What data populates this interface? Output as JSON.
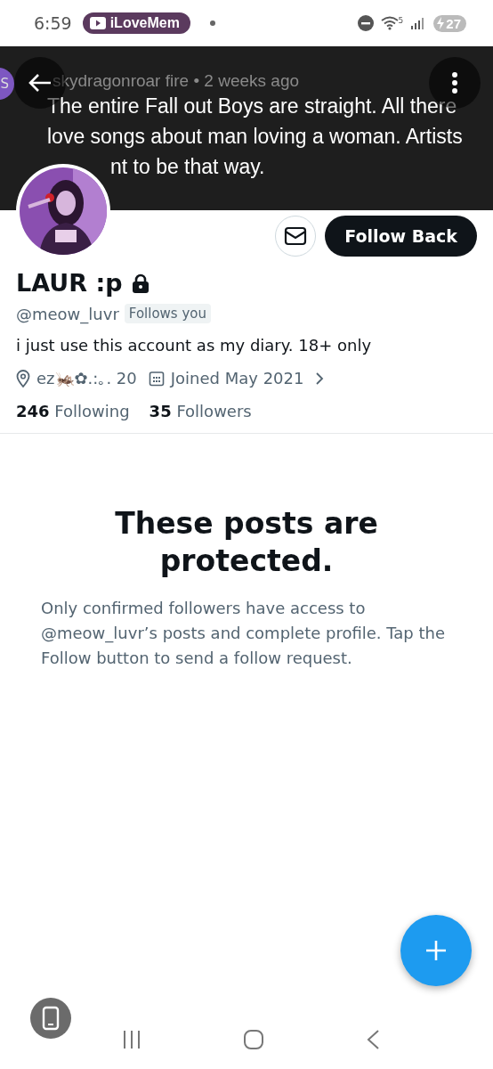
{
  "status_bar": {
    "time": "6:59",
    "notification_pill": "iLoveMem",
    "wifi_label": "5",
    "battery": "27"
  },
  "header": {
    "comment_avatar": "S",
    "comment_meta": "skydragonroar fire • 2 weeks ago",
    "comment_text": "The entire Fall out Boys are straight. All there love songs about man loving a woman. Artists",
    "comment_text_cut": "nt to be that way."
  },
  "profile": {
    "follow_button": "Follow Back",
    "name": "LAUR :p",
    "locked": true,
    "handle": "@meow_luvr",
    "follows_you": "Follows you",
    "bio": "i just use this account as my diary. 18+ only",
    "location": "ez🦗✿.:｡. 20",
    "joined": "Joined May 2021",
    "following_count": "246",
    "following_label": "Following",
    "followers_count": "35",
    "followers_label": "Followers"
  },
  "protected": {
    "title": "These posts are protected.",
    "text": "Only confirmed followers have access to @meow_luvr’s posts and complete profile. Tap the Follow button to send a follow request."
  }
}
